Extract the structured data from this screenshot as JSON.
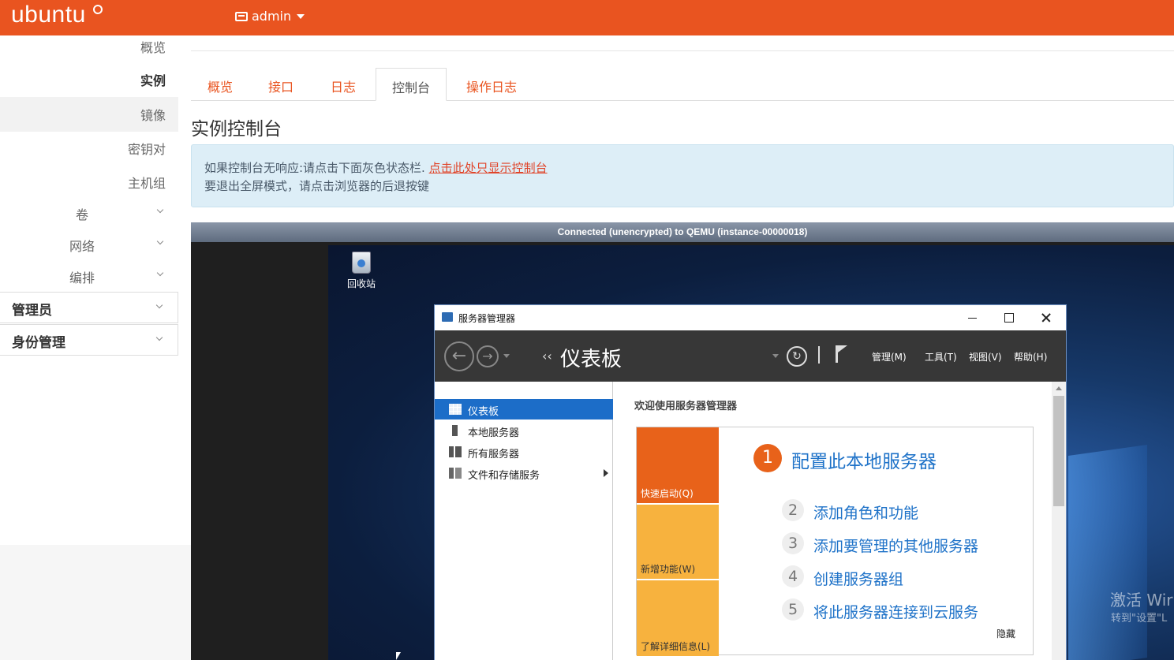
{
  "header": {
    "brand": "ubuntu",
    "user_menu": "admin",
    "brand_color": "#e95420"
  },
  "sidebar": {
    "items": [
      {
        "label": "概览"
      },
      {
        "label": "实例"
      },
      {
        "label": "镜像"
      },
      {
        "label": "密钥对"
      },
      {
        "label": "主机组"
      }
    ],
    "groups": [
      {
        "label": "卷"
      },
      {
        "label": "网络"
      },
      {
        "label": "编排"
      }
    ],
    "sections": [
      {
        "label": "管理员"
      },
      {
        "label": "身份管理"
      }
    ]
  },
  "tabs": [
    {
      "label": "概览"
    },
    {
      "label": "接口"
    },
    {
      "label": "日志"
    },
    {
      "label": "控制台"
    },
    {
      "label": "操作日志"
    }
  ],
  "page_title": "实例控制台",
  "alert": {
    "line1_text": "如果控制台无响应:请点击下面灰色状态栏.",
    "line1_link": "点击此处只显示控制台",
    "line2_text": "要退出全屏模式，请点击浏览器的后退按键"
  },
  "console": {
    "status": "Connected (unencrypted) to QEMU (instance-00000018)",
    "desktop": {
      "recycle_bin": "回收站",
      "activate_line1": "激活 Wir",
      "activate_line2": "转到\"设置\"L"
    },
    "server_manager": {
      "window_title": "服务器管理器",
      "breadcrumb": "仪表板",
      "menus": [
        "管理(M)",
        "工具(T)",
        "视图(V)",
        "帮助(H)"
      ],
      "nav": [
        {
          "label": "仪表板"
        },
        {
          "label": "本地服务器"
        },
        {
          "label": "所有服务器"
        },
        {
          "label": "文件和存储服务"
        }
      ],
      "welcome": "欢迎使用服务器管理器",
      "tiles": [
        "快速启动(Q)",
        "新增功能(W)",
        "了解详细信息(L)"
      ],
      "steps": [
        {
          "num": "1",
          "label": "配置此本地服务器"
        },
        {
          "num": "2",
          "label": "添加角色和功能"
        },
        {
          "num": "3",
          "label": "添加要管理的其他服务器"
        },
        {
          "num": "4",
          "label": "创建服务器组"
        },
        {
          "num": "5",
          "label": "将此服务器连接到云服务"
        }
      ],
      "hide": "隐藏"
    }
  }
}
